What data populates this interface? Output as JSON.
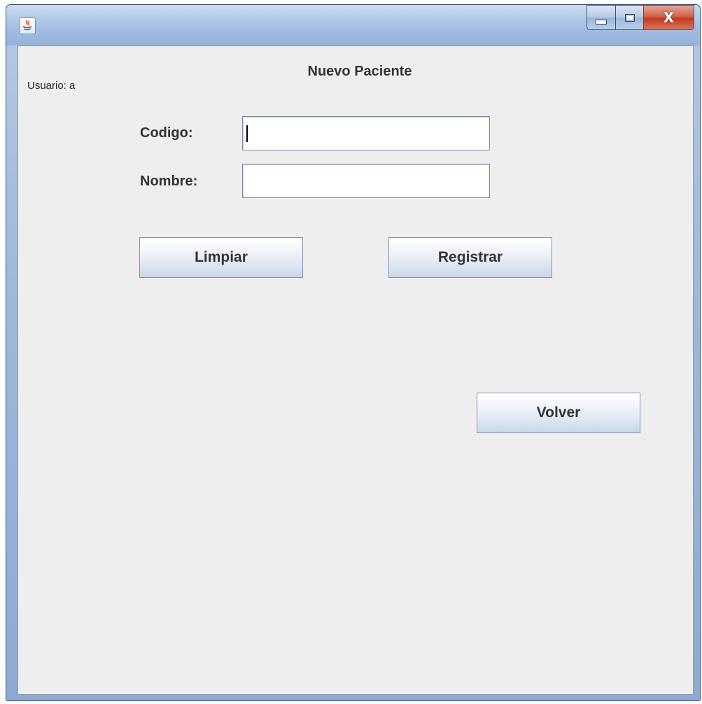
{
  "window": {
    "controls": {
      "minimize": "minimize",
      "maximize": "maximize",
      "close": "X"
    }
  },
  "form": {
    "title": "Nuevo Paciente",
    "user_label": "Usuario: a",
    "fields": {
      "codigo": {
        "label": "Codigo:",
        "value": ""
      },
      "nombre": {
        "label": "Nombre:",
        "value": ""
      }
    },
    "buttons": {
      "limpiar": "Limpiar",
      "registrar": "Registrar",
      "volver": "Volver"
    }
  },
  "colors": {
    "client_background": "#eeeeee",
    "close_button": "#c23b22",
    "title_bar": "#a2bde0"
  },
  "icons": {
    "app": "java-coffee-cup-icon",
    "minimize": "minimize-icon",
    "maximize": "maximize-icon",
    "close": "close-icon"
  }
}
